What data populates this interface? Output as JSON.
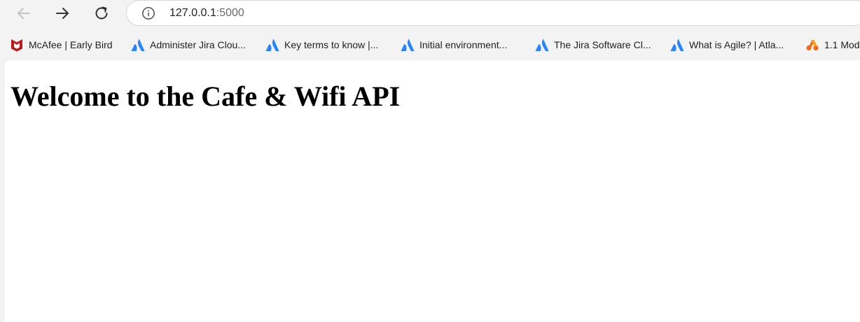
{
  "browser": {
    "toolbar": {
      "back_icon": "arrow-left-icon",
      "forward_icon": "arrow-right-icon",
      "reload_icon": "reload-icon",
      "site_info_icon": "info-icon"
    },
    "address_bar": {
      "host": "127.0.0.1",
      "port": ":5000"
    },
    "bookmarks": [
      {
        "label": "McAfee | Early Bird",
        "icon": "mcafee-icon"
      },
      {
        "label": "Administer Jira Clou...",
        "icon": "atlassian-icon"
      },
      {
        "label": "Key terms to know |...",
        "icon": "atlassian-icon"
      },
      {
        "label": "Initial environment...",
        "icon": "atlassian-icon"
      },
      {
        "label": "The Jira Software Cl...",
        "icon": "atlassian-icon"
      },
      {
        "label": "What is Agile? | Atla...",
        "icon": "atlassian-icon"
      },
      {
        "label": "1.1 Mod",
        "icon": "orange-logo-icon"
      }
    ],
    "colors": {
      "atlassian_blue": "#2684ff",
      "mcafee_red": "#c01818",
      "orange_logo": "#f26a1b"
    }
  },
  "page": {
    "heading": "Welcome to the Cafe & Wifi API"
  }
}
